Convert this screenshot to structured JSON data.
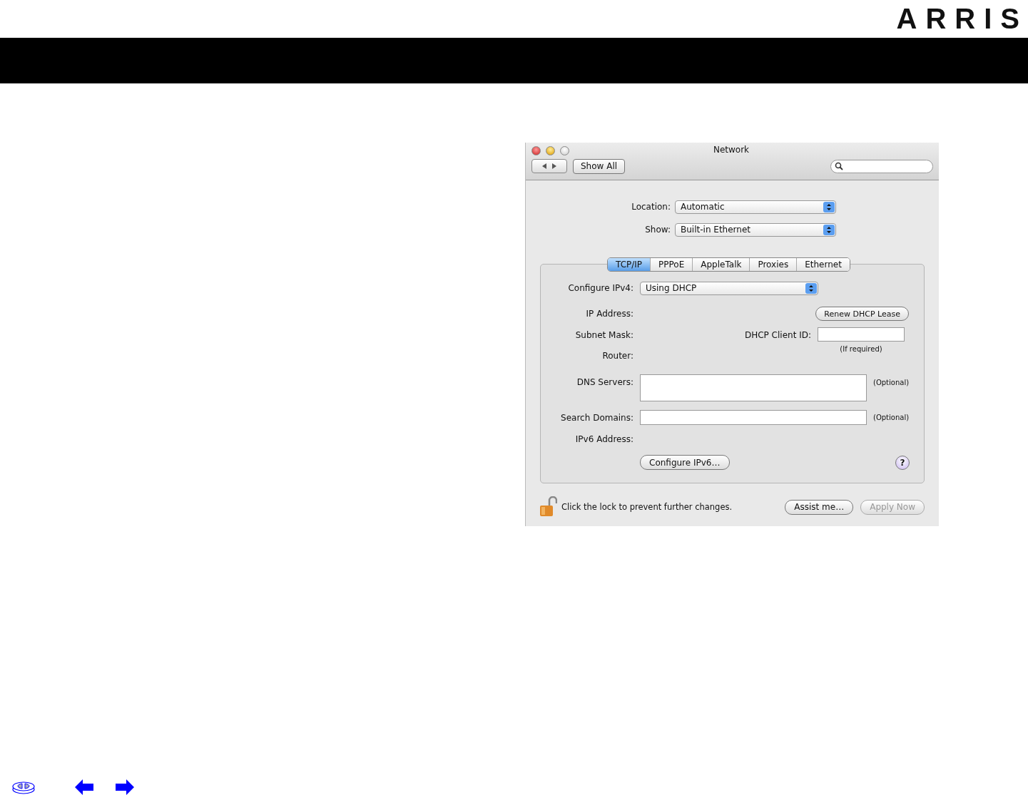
{
  "logo": "ARRIS",
  "window": {
    "title": "Network",
    "show_all": "Show All"
  },
  "location": {
    "label": "Location:",
    "value": "Automatic"
  },
  "show": {
    "label": "Show:",
    "value": "Built-in Ethernet"
  },
  "tabs": [
    {
      "label": "TCP/IP",
      "selected": true
    },
    {
      "label": "PPPoE",
      "selected": false
    },
    {
      "label": "AppleTalk",
      "selected": false
    },
    {
      "label": "Proxies",
      "selected": false
    },
    {
      "label": "Ethernet",
      "selected": false
    }
  ],
  "configure_ipv4": {
    "label": "Configure IPv4:",
    "value": "Using DHCP"
  },
  "ip_address": {
    "label": "IP Address:",
    "button": "Renew DHCP Lease"
  },
  "subnet_mask": {
    "label": "Subnet Mask:",
    "client_id_label": "DHCP Client ID:",
    "client_id_note": "(If required)"
  },
  "router": {
    "label": "Router:"
  },
  "dns_servers": {
    "label": "DNS Servers:",
    "note": "(Optional)"
  },
  "search_domains": {
    "label": "Search Domains:",
    "note": "(Optional)"
  },
  "ipv6_address": {
    "label": "IPv6 Address:"
  },
  "configure_ipv6": "Configure IPv6…",
  "help": "?",
  "lock": {
    "text": "Click the lock to prevent further changes.",
    "locked": false
  },
  "buttons": [
    {
      "label": "Assist me…",
      "disabled": false
    },
    {
      "label": "Apply Now",
      "disabled": true
    }
  ]
}
